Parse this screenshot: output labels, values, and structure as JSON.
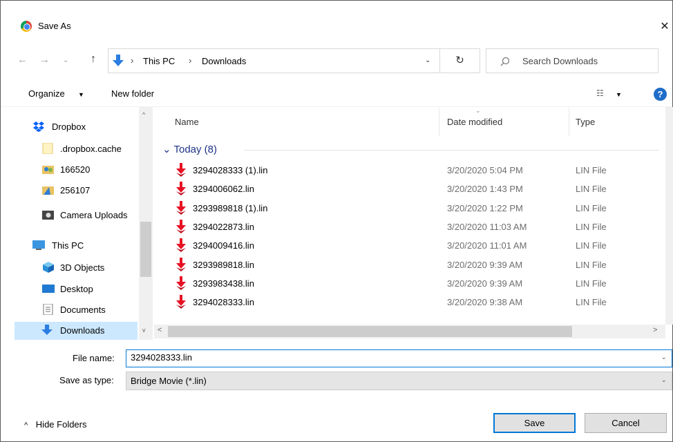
{
  "window": {
    "title": "Save As",
    "close_glyph": "✕"
  },
  "nav": {
    "back_glyph": "←",
    "forward_glyph": "→",
    "recent_glyph": "⌄",
    "up_glyph": "↑"
  },
  "address": {
    "path": [
      "This PC",
      "Downloads"
    ],
    "separator": "›",
    "dropdown_glyph": "⌄",
    "refresh_glyph": "↻"
  },
  "search": {
    "placeholder": "Search Downloads",
    "icon": "search-icon"
  },
  "toolbar": {
    "organize_label": "Organize",
    "organize_caret": "▼",
    "new_folder_label": "New folder",
    "view_glyph": "☷",
    "view_caret": "▼",
    "help_label": "?"
  },
  "sidebar": {
    "items": [
      {
        "label": "Dropbox",
        "icon": "dropbox-icon"
      },
      {
        "label": ".dropbox.cache",
        "icon": "folder-icon"
      },
      {
        "label": "166520",
        "icon": "shared-folder-icon"
      },
      {
        "label": "256107",
        "icon": "folder-icon"
      },
      {
        "label": "Camera Uploads",
        "icon": "camera-folder-icon"
      },
      {
        "label": "This PC",
        "icon": "computer-icon"
      },
      {
        "label": "3D Objects",
        "icon": "3d-objects-icon"
      },
      {
        "label": "Desktop",
        "icon": "desktop-icon"
      },
      {
        "label": "Documents",
        "icon": "documents-icon"
      },
      {
        "label": "Downloads",
        "icon": "downloads-icon",
        "selected": true
      }
    ],
    "scroll_up": "^",
    "scroll_down": "v"
  },
  "filelist": {
    "columns": {
      "name": "Name",
      "date": "Date modified",
      "type": "Type",
      "sort_caret": "⌄"
    },
    "group": {
      "caret": "⌄",
      "label": "Today (8)"
    },
    "files": [
      {
        "name": "3294028333 (1).lin",
        "date": "3/20/2020 5:04 PM",
        "type": "LIN File"
      },
      {
        "name": "3294006062.lin",
        "date": "3/20/2020 1:43 PM",
        "type": "LIN File"
      },
      {
        "name": "3293989818 (1).lin",
        "date": "3/20/2020 1:22 PM",
        "type": "LIN File"
      },
      {
        "name": "3294022873.lin",
        "date": "3/20/2020 11:03 AM",
        "type": "LIN File"
      },
      {
        "name": "3294009416.lin",
        "date": "3/20/2020 11:01 AM",
        "type": "LIN File"
      },
      {
        "name": "3293989818.lin",
        "date": "3/20/2020 9:39 AM",
        "type": "LIN File"
      },
      {
        "name": "3293983438.lin",
        "date": "3/20/2020 9:39 AM",
        "type": "LIN File"
      },
      {
        "name": "3294028333.lin",
        "date": "3/20/2020 9:38 AM",
        "type": "LIN File"
      }
    ],
    "hscroll_left": "<",
    "hscroll_right": ">"
  },
  "form": {
    "file_name_label": "File name:",
    "file_name_value": "3294028333.lin",
    "save_type_label": "Save as type:",
    "save_type_value": "Bridge Movie (*.lin)",
    "dropdown_glyph": "⌄"
  },
  "footer": {
    "hide_folders_caret": "^",
    "hide_folders_label": "Hide Folders",
    "save_label": "Save",
    "cancel_label": "Cancel"
  },
  "colors": {
    "accent": "#0078d7",
    "selection": "#cce8ff",
    "group_header": "#1e3287",
    "file_icon": "#e81123"
  }
}
